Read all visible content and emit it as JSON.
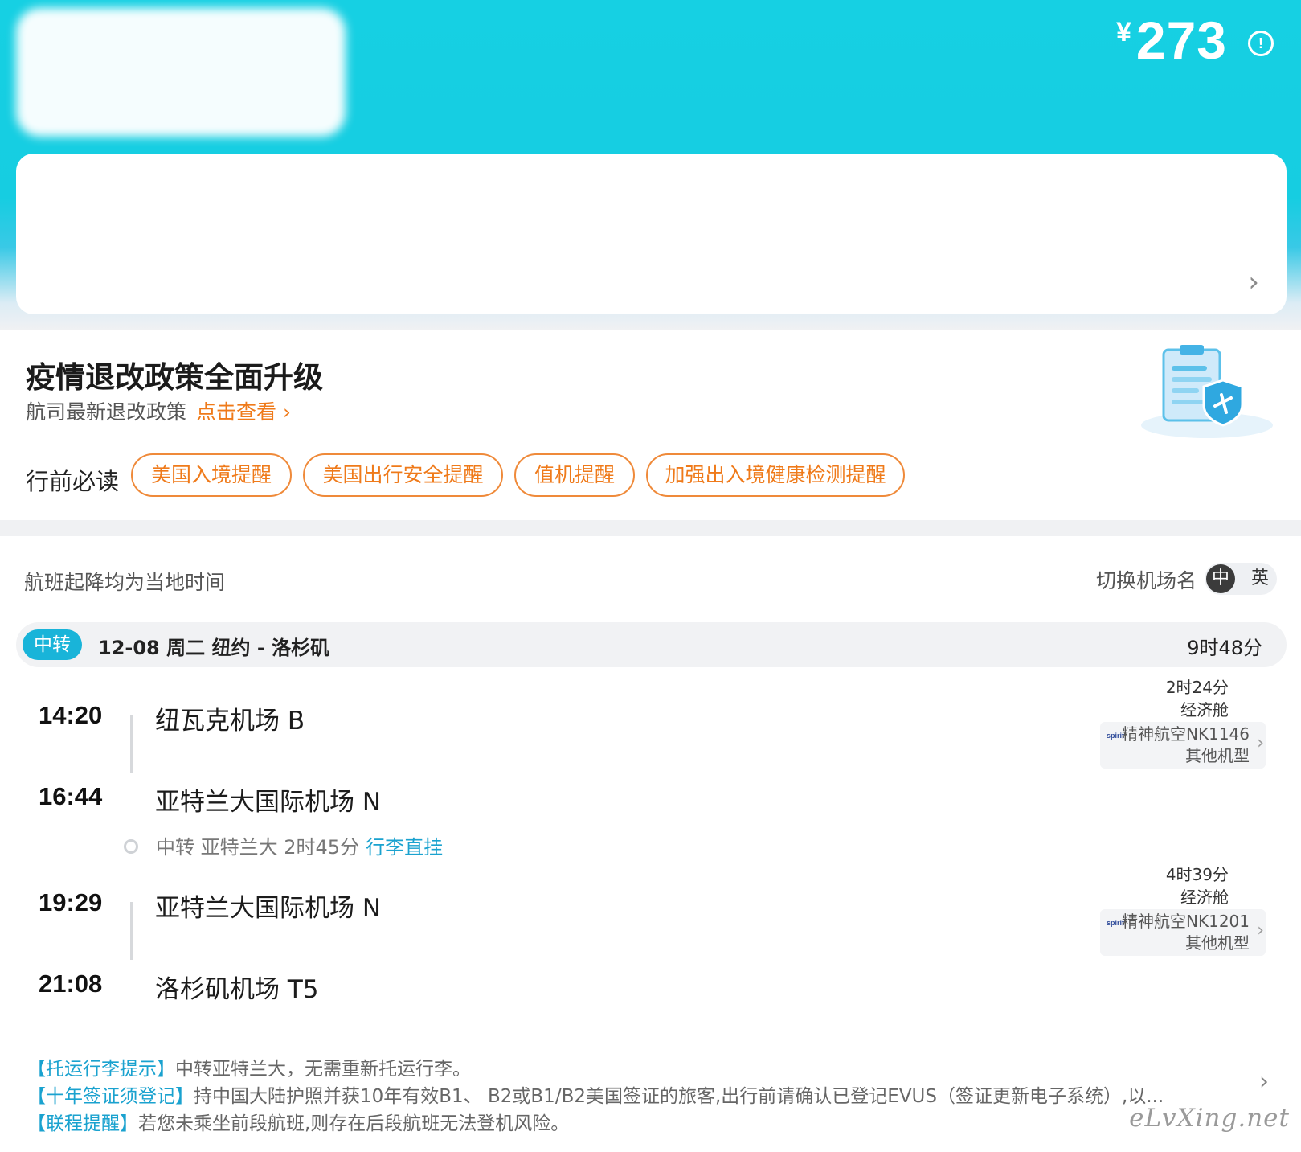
{
  "header": {
    "currency_symbol": "¥",
    "price": "273",
    "info_icon": "!",
    "card_chevron": "›"
  },
  "policy": {
    "title": "疫情退改政策全面升级",
    "subtitle": "航司最新退改政策",
    "link": "点击查看 ›",
    "must_read_label": "行前必读",
    "pills": [
      "美国入境提醒",
      "美国出行安全提醒",
      "值机提醒",
      "加强出入境健康检测提醒"
    ]
  },
  "flight": {
    "local_time_note": "航班起降均为当地时间",
    "switch_label": "切换机场名",
    "lang_on": "中",
    "lang_off": "英",
    "transfer_badge": "中转",
    "route": "12-08  周二  纽约 - 洛杉矶",
    "total_duration": "9时48分",
    "segments": [
      {
        "dep_time": "14:20",
        "dep_airport": "纽瓦克机场 B",
        "arr_time": "16:44",
        "arr_airport": "亚特兰大国际机场 N",
        "duration": "2时24分",
        "cabin": "经济舱",
        "airline_logo": "spirit",
        "airline": "精神航空NK1146",
        "aircraft": "其他机型"
      },
      {
        "dep_time": "19:29",
        "dep_airport": "亚特兰大国际机场 N",
        "arr_time": "21:08",
        "arr_airport": "洛杉矶机场 T5",
        "duration": "4时39分",
        "cabin": "经济舱",
        "airline_logo": "spirit",
        "airline": "精神航空NK1201",
        "aircraft": "其他机型"
      }
    ],
    "transfer_text": "中转 亚特兰大 2时45分",
    "transfer_link": "行李直挂"
  },
  "notices": [
    {
      "tag": "【托运行李提示】",
      "text": "中转亚特兰大，无需重新托运行李。"
    },
    {
      "tag": "【十年签证须登记】",
      "text": "持中国大陆护照并获10年有效B1、 B2或B1/B2美国签证的旅客,出行前请确认已登记EVUS（签证更新电子系统）,以..."
    },
    {
      "tag": "【联程提醒】",
      "text": "若您未乘坐前段航班,则存在后段航班无法登机风险。"
    }
  ],
  "watermark": "eLvXing.net",
  "icons": [
    "info-icon",
    "chevron-right-icon",
    "policy-shield-icon",
    "spirit-logo-icon",
    "transfer-dot-icon"
  ],
  "colors": {
    "header": "#16d0e3",
    "accent_orange": "#ef7a1a",
    "accent_blue": "#1aa2cf"
  }
}
